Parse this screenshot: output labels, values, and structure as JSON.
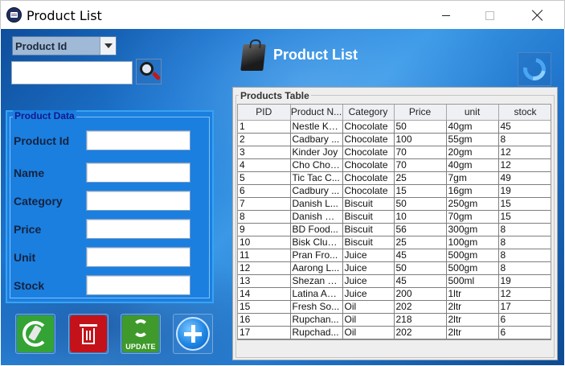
{
  "window": {
    "title": "Product List",
    "app_icon": "product-list-app-icon",
    "controls": [
      "minimize",
      "maximize",
      "close"
    ]
  },
  "search": {
    "field_selected": "Product Id",
    "query": "",
    "icon": "magnifier-icon"
  },
  "product_data": {
    "legend": "Product Data",
    "fields": [
      {
        "label": "Product Id",
        "value": ""
      },
      {
        "label": "Name",
        "value": ""
      },
      {
        "label": "Category",
        "value": ""
      },
      {
        "label": "Price",
        "value": ""
      },
      {
        "label": "Unit",
        "value": ""
      },
      {
        "label": "Stock",
        "value": ""
      }
    ]
  },
  "actions": {
    "clear_icon": "clear-icon",
    "delete_icon": "trash-icon",
    "update_label": "UPDATE",
    "add_icon": "plus-icon"
  },
  "header": {
    "title": "Product List",
    "icon": "shopping-bag-icon",
    "refresh_icon": "refresh-icon"
  },
  "products_table": {
    "legend": "Products Table",
    "columns": [
      "PID",
      "Product N...",
      "Category",
      "Price",
      "unit",
      "stock"
    ],
    "rows": [
      [
        "1",
        "Nestle Kit...",
        "Chocolate",
        "50",
        "40gm",
        "45"
      ],
      [
        "2",
        "Cadbary ...",
        "Chocolate",
        "100",
        "55gm",
        "8"
      ],
      [
        "3",
        "Kinder Joy",
        "Chocolate",
        "70",
        "20gm",
        "12"
      ],
      [
        "4",
        "Cho Cho ...",
        "Chocolate",
        "70",
        "40gm",
        "12"
      ],
      [
        "5",
        "Tic Tac C...",
        "Chocolate",
        "25",
        "7gm",
        "49"
      ],
      [
        "6",
        "Cadbury ...",
        "Chocolate",
        "15",
        "16gm",
        "19"
      ],
      [
        "7",
        "Danish L...",
        "Biscuit",
        "50",
        "250gm",
        "15"
      ],
      [
        "8",
        "Danish M...",
        "Biscuit",
        "10",
        "70gm",
        "15"
      ],
      [
        "9",
        "BD Food...",
        "Biscuit",
        "56",
        "300gm",
        "8"
      ],
      [
        "10",
        "Bisk Club...",
        "Biscuit",
        "25",
        "100gm",
        "8"
      ],
      [
        "11",
        "Pran Fro...",
        "Juice",
        "45",
        "500gm",
        "8"
      ],
      [
        "12",
        "Aarong L...",
        "Juice",
        "50",
        "500gm",
        "8"
      ],
      [
        "13",
        "Shezan M...",
        "Juice",
        "45",
        "500ml",
        "19"
      ],
      [
        "14",
        "Latina Ap...",
        "Juice",
        "200",
        "1ltr",
        "12"
      ],
      [
        "15",
        "Fresh So...",
        "Oil",
        "202",
        "2ltr",
        "17"
      ],
      [
        "16",
        "Rupchan...",
        "Oil",
        "218",
        "2ltr",
        "6"
      ],
      [
        "17",
        "Rupchad...",
        "Oil",
        "202",
        "2ltr",
        "6"
      ]
    ]
  },
  "colors": {
    "background_blue": "#1e78d2",
    "panel_blue": "#1b7fe0",
    "legend_text": "#101a8a"
  }
}
